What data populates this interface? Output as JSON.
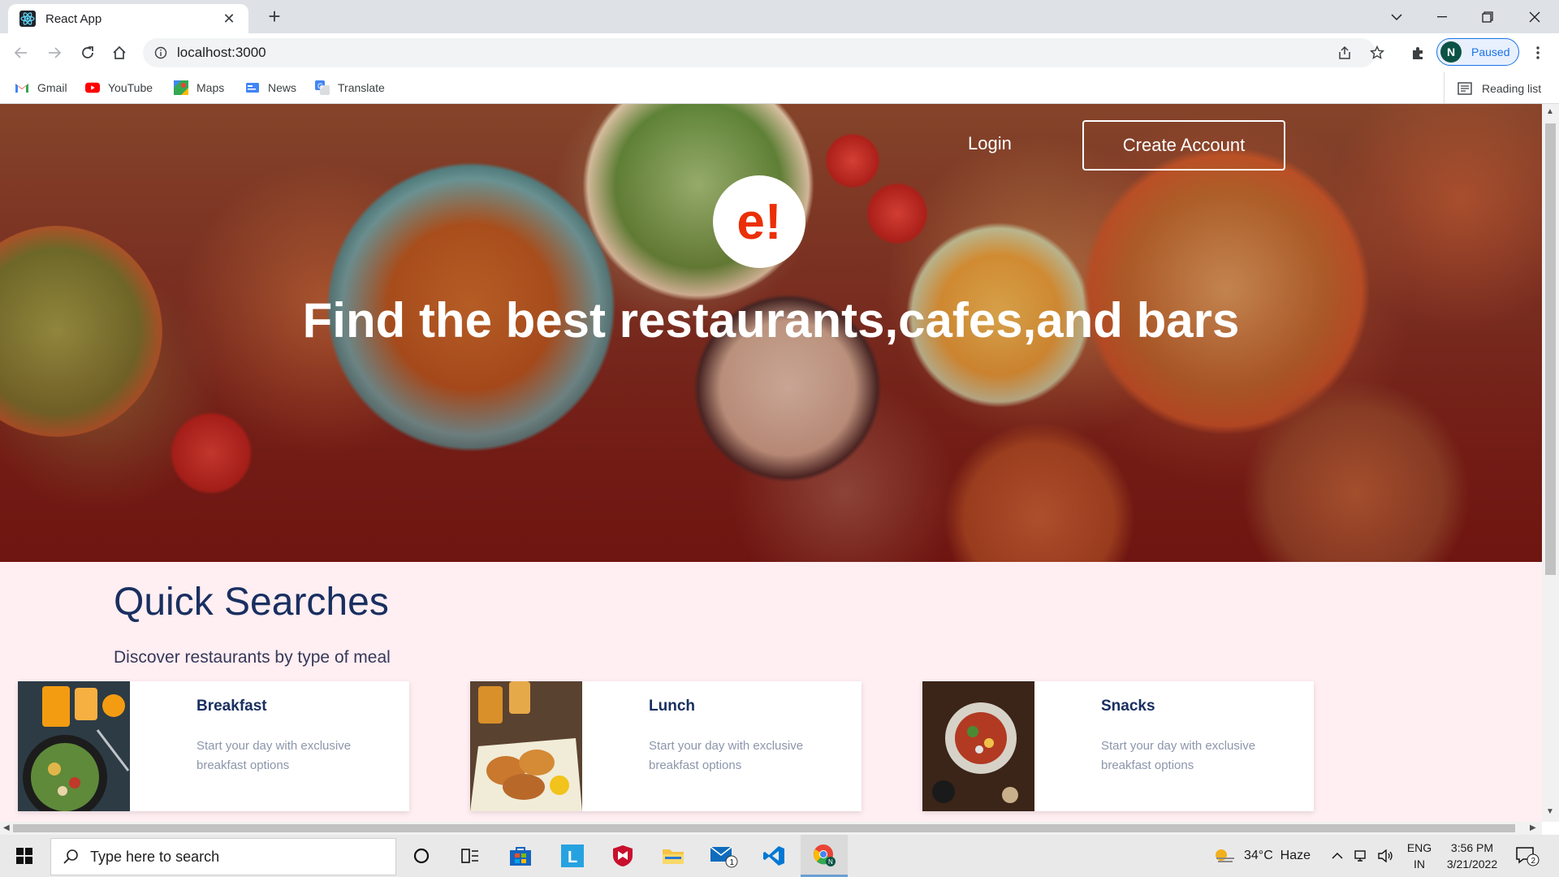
{
  "browser": {
    "tab_title": "React App",
    "url": "localhost:3000",
    "profile_initial": "N",
    "profile_status": "Paused",
    "bookmarks": [
      {
        "label": "Gmail",
        "icon": "gmail-icon"
      },
      {
        "label": "YouTube",
        "icon": "youtube-icon"
      },
      {
        "label": "Maps",
        "icon": "maps-icon"
      },
      {
        "label": "News",
        "icon": "news-icon"
      },
      {
        "label": "Translate",
        "icon": "translate-icon"
      }
    ],
    "reading_list": "Reading list"
  },
  "hero": {
    "login": "Login",
    "create_account": "Create Account",
    "logo": "e!",
    "title": "Find the best restaurants,cafes,and bars"
  },
  "quick_searches": {
    "title": "Quick Searches",
    "subtitle": "Discover restaurants by type of meal",
    "cards": [
      {
        "name": "Breakfast",
        "desc": "Start your day with exclusive breakfast options"
      },
      {
        "name": "Lunch",
        "desc": "Start your day with exclusive breakfast options"
      },
      {
        "name": "Snacks",
        "desc": "Start your day with exclusive breakfast options"
      }
    ]
  },
  "taskbar": {
    "search_placeholder": "Type here to search",
    "weather": "34°C  Haze",
    "lang_line1": "ENG",
    "lang_line2": "IN",
    "time": "3:56 PM",
    "date": "3/21/2022",
    "mail_badge": "1",
    "notif_badge": "2"
  },
  "colors": {
    "accent_logo": "#eb2f06",
    "heading": "#192f60",
    "page_bg": "#ffeef2"
  }
}
